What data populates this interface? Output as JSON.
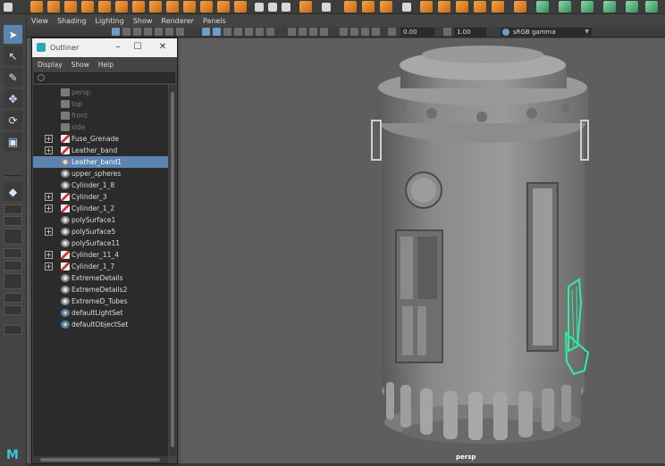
{
  "panel_menu": [
    "View",
    "Shading",
    "Lighting",
    "Show",
    "Renderer",
    "Panels"
  ],
  "panel_toolbar": {
    "exposure_value": "0.00",
    "gamma_value": "1.00",
    "color_space": "sRGB gamma"
  },
  "outliner": {
    "title": "Outliner",
    "menu": [
      "Display",
      "Show",
      "Help"
    ],
    "items": [
      {
        "label": "persp",
        "icon": "camera-icon",
        "expandable": false,
        "selected": false,
        "dim": true
      },
      {
        "label": "top",
        "icon": "camera-icon",
        "expandable": false,
        "selected": false,
        "dim": true
      },
      {
        "label": "front",
        "icon": "camera-icon",
        "expandable": false,
        "selected": false,
        "dim": true
      },
      {
        "label": "side",
        "icon": "camera-icon",
        "expandable": false,
        "selected": false,
        "dim": true
      },
      {
        "label": "Fuse_Grenade",
        "icon": "mesh-icon",
        "expandable": true,
        "selected": false,
        "dim": false
      },
      {
        "label": "Leather_band",
        "icon": "mesh-icon",
        "expandable": true,
        "selected": false,
        "dim": false
      },
      {
        "label": "Leather_band1",
        "icon": "group-icon",
        "expandable": false,
        "selected": true,
        "dim": false
      },
      {
        "label": "upper_spheres",
        "icon": "group-icon",
        "expandable": false,
        "selected": false,
        "dim": false
      },
      {
        "label": "Cylinder_1_8",
        "icon": "group-icon",
        "expandable": false,
        "selected": false,
        "dim": false
      },
      {
        "label": "Cylinder_3",
        "icon": "mesh-icon",
        "expandable": true,
        "selected": false,
        "dim": false
      },
      {
        "label": "Cylinder_1_2",
        "icon": "mesh-icon",
        "expandable": true,
        "selected": false,
        "dim": false
      },
      {
        "label": "polySurface1",
        "icon": "group-icon",
        "expandable": false,
        "selected": false,
        "dim": false
      },
      {
        "label": "polySurface5",
        "icon": "group-icon",
        "expandable": true,
        "selected": false,
        "dim": false
      },
      {
        "label": "polySurface11",
        "icon": "group-icon",
        "expandable": false,
        "selected": false,
        "dim": false
      },
      {
        "label": "Cylinder_11_4",
        "icon": "mesh-icon",
        "expandable": true,
        "selected": false,
        "dim": false
      },
      {
        "label": "Cylinder_1_7",
        "icon": "mesh-icon",
        "expandable": true,
        "selected": false,
        "dim": false
      },
      {
        "label": "ExtremeDetails",
        "icon": "group-icon",
        "expandable": false,
        "selected": false,
        "dim": false
      },
      {
        "label": "ExtremeDetails2",
        "icon": "group-icon",
        "expandable": false,
        "selected": false,
        "dim": false
      },
      {
        "label": "ExtremeD_Tubes",
        "icon": "group-icon",
        "expandable": false,
        "selected": false,
        "dim": false
      },
      {
        "label": "defaultLightSet",
        "icon": "set-icon",
        "expandable": false,
        "selected": false,
        "dim": false
      },
      {
        "label": "defaultObjectSet",
        "icon": "set-icon",
        "expandable": false,
        "selected": false,
        "dim": false
      }
    ]
  },
  "viewport": {
    "camera_label": "persp",
    "selection_color": "#2ef0a0",
    "background_color": "#5e5e5e"
  },
  "colors": {
    "accent": "#5b84b1",
    "shelf_orange": "#e8892a"
  }
}
